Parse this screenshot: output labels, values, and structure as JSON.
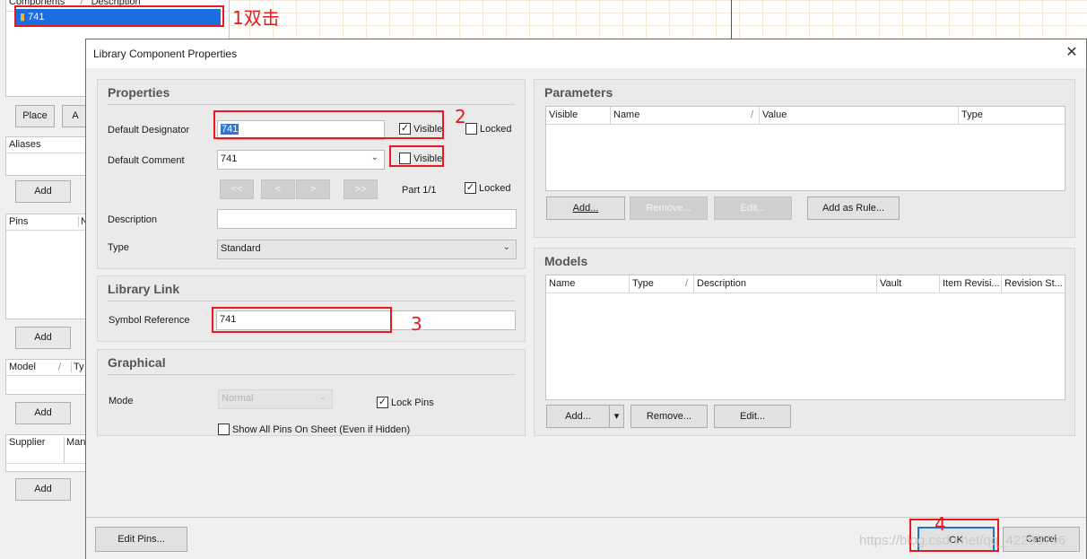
{
  "background": {
    "components_header": {
      "name": "Components",
      "desc": "Description"
    },
    "selected_component": "741",
    "place_label": "Place",
    "a_label": "A",
    "aliases_header": "Aliases",
    "add_label": "Add",
    "pins_header": {
      "col1": "Pins",
      "col2": "N"
    },
    "model_header": {
      "col1": "Model",
      "col2": "Ty"
    },
    "supplier_header": {
      "col1": "Supplier",
      "col2": "Man"
    }
  },
  "dialog": {
    "title": "Library Component Properties",
    "close_glyph": "✕",
    "properties": {
      "title": "Properties",
      "default_designator_label": "Default Designator",
      "default_designator_value": "741",
      "designator_visible_label": "Visible",
      "designator_visible_checked": true,
      "designator_locked_label": "Locked",
      "designator_locked_checked": false,
      "default_comment_label": "Default Comment",
      "default_comment_value": "741",
      "comment_visible_label": "Visible",
      "comment_visible_checked": false,
      "part_nav": [
        "<<",
        "<",
        ">",
        ">>"
      ],
      "part_label": "Part 1/1",
      "part_locked_label": "Locked",
      "part_locked_checked": true,
      "description_label": "Description",
      "description_value": "",
      "type_label": "Type",
      "type_value": "Standard"
    },
    "library_link": {
      "title": "Library Link",
      "symbol_reference_label": "Symbol Reference",
      "symbol_reference_value": "741"
    },
    "graphical": {
      "title": "Graphical",
      "mode_label": "Mode",
      "mode_value": "Normal",
      "lock_pins_label": "Lock Pins",
      "lock_pins_checked": true,
      "show_all_pins_label": "Show All Pins On Sheet (Even if Hidden)",
      "show_all_pins_checked": false
    },
    "parameters": {
      "title": "Parameters",
      "columns": [
        "Visible",
        "Name",
        "Value",
        "Type"
      ],
      "sort_glyph": "/",
      "add_label": "Add...",
      "remove_label": "Remove...",
      "edit_label": "Edit...",
      "add_as_rule_label": "Add as Rule..."
    },
    "models": {
      "title": "Models",
      "columns": [
        "Name",
        "Type",
        "Description",
        "Vault",
        "Item Revisi...",
        "Revision St..."
      ],
      "sort_glyph": "/",
      "add_label": "Add...",
      "dropdown_glyph": "▾",
      "remove_label": "Remove...",
      "edit_label": "Edit..."
    },
    "footer": {
      "edit_pins_label": "Edit Pins...",
      "ok_label": "OK",
      "cancel_label": "Cancel"
    }
  },
  "annotations": {
    "step1": "1双击",
    "step2": "2",
    "step3": "3",
    "step4": "4",
    "color": "#e5191f"
  },
  "watermark": "https://blog.csdn.net/qq_42263796"
}
